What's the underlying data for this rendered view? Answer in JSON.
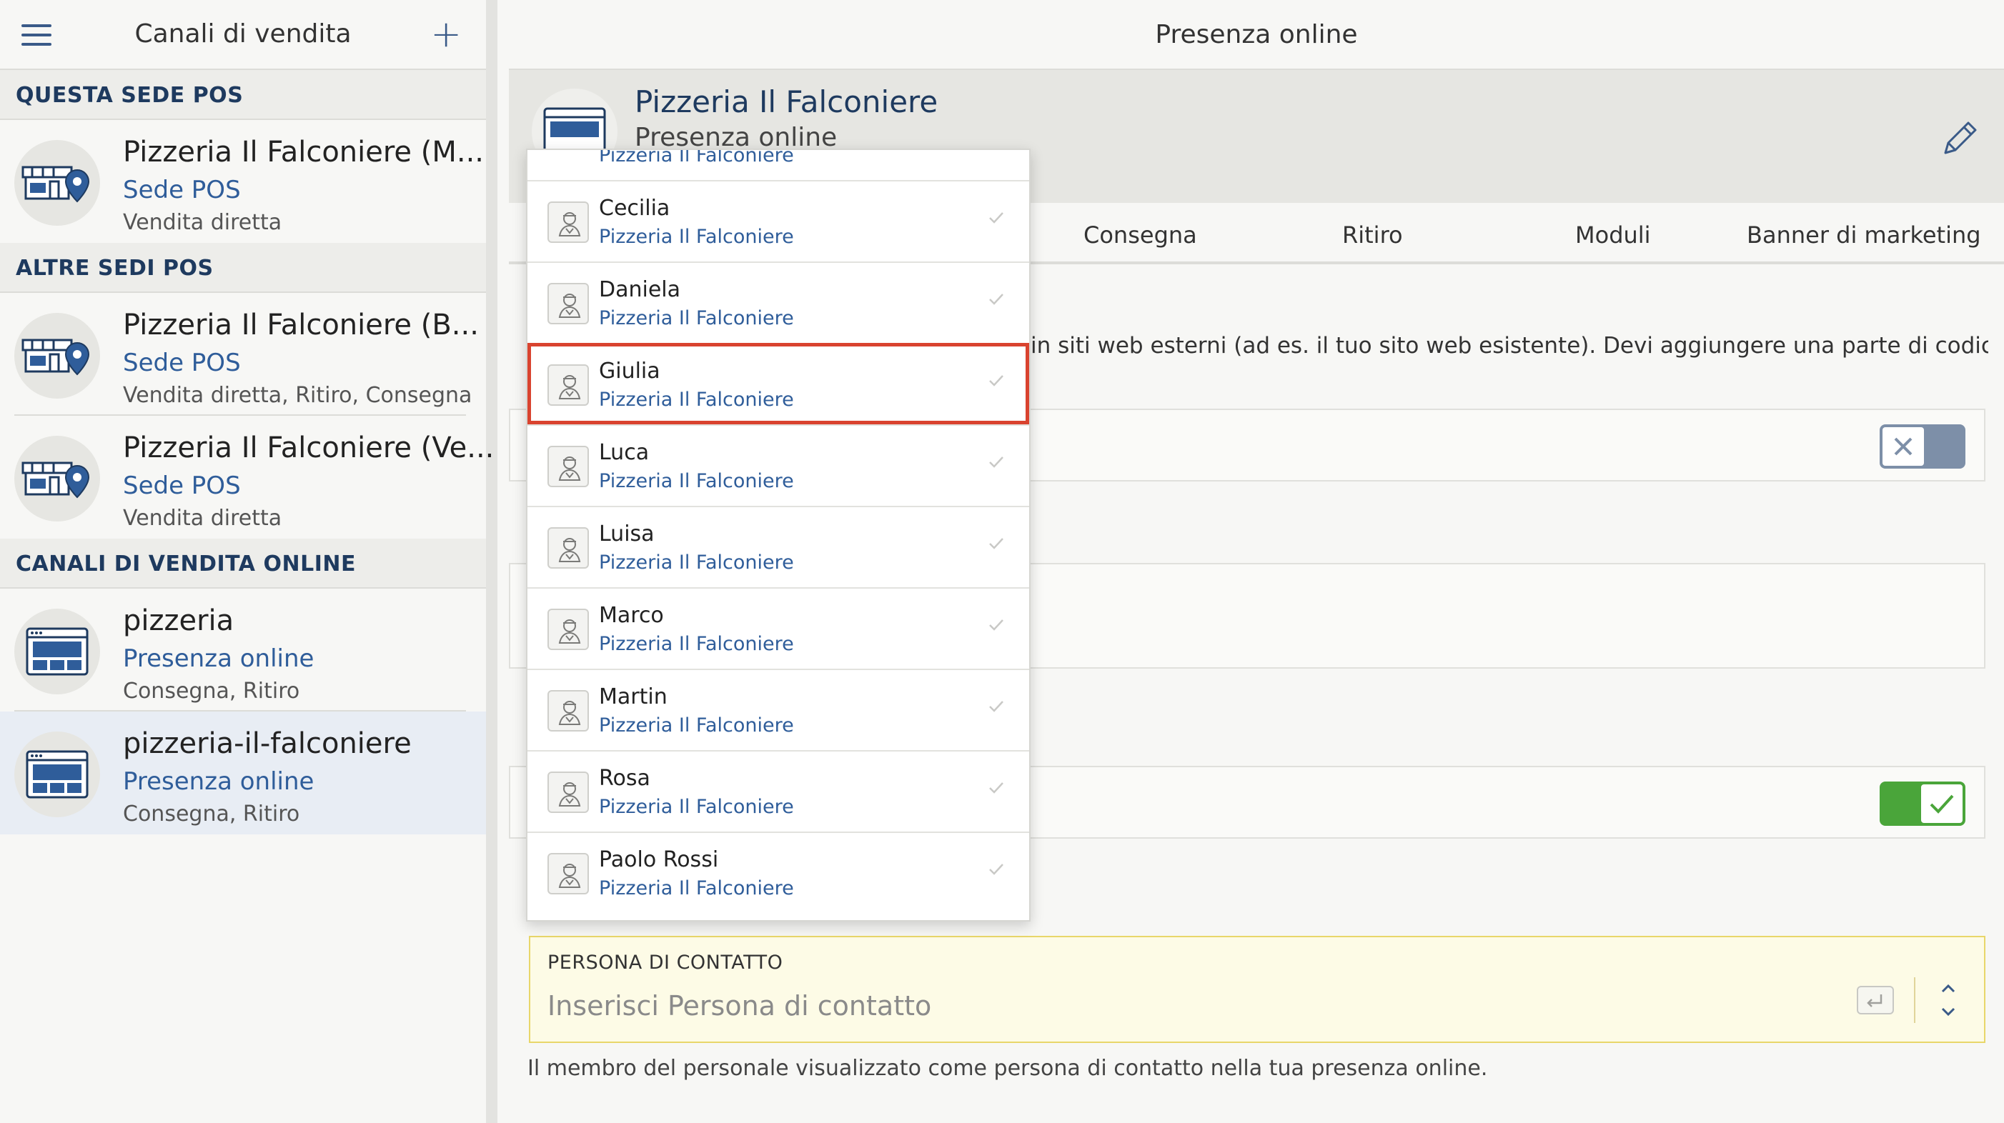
{
  "sidebar": {
    "title": "Canali di vendita",
    "menu_icon": "hamburger-icon",
    "add_icon": "plus-icon",
    "sections": [
      {
        "header": "QUESTA SEDE POS",
        "items": [
          {
            "name": "Pizzeria Il Falconiere (M...",
            "type": "Sede POS",
            "meta": "Vendita diretta",
            "icon": "store-location-icon",
            "selected": false
          }
        ]
      },
      {
        "header": "ALTRE SEDI POS",
        "items": [
          {
            "name": "Pizzeria Il Falconiere (B...",
            "type": "Sede POS",
            "meta": "Vendita diretta, Ritiro, Consegna",
            "icon": "store-location-icon",
            "selected": false
          },
          {
            "name": "Pizzeria Il Falconiere (Ve...",
            "type": "Sede POS",
            "meta": "Vendita diretta",
            "icon": "store-location-icon",
            "selected": false
          }
        ]
      },
      {
        "header": "CANALI DI VENDITA ONLINE",
        "items": [
          {
            "name": "pizzeria",
            "type": "Presenza online",
            "meta": "Consegna, Ritiro",
            "icon": "website-icon",
            "selected": false
          },
          {
            "name": "pizzeria-il-falconiere",
            "type": "Presenza online",
            "meta": "Consegna, Ritiro",
            "icon": "website-icon",
            "selected": true
          }
        ]
      }
    ]
  },
  "main": {
    "header_title": "Presenza online",
    "banner": {
      "title": "Pizzeria Il Falconiere",
      "subtitle": "Presenza online",
      "edit_icon": "pencil-icon"
    },
    "tabs": [
      "Consegna",
      "Ritiro",
      "Moduli",
      "Banner di marketing"
    ],
    "description": "in siti web esterni (ad es. il tuo sito web esistente). Devi aggiungere una parte di codice HTML al sito",
    "toggle_1": "off",
    "toggle_2": "on",
    "contact": {
      "label": "PERSONA DI CONTATTO",
      "placeholder": "Inserisci Persona di contatto",
      "help": "Il membro del personale visualizzato come persona di contatto nella tua presenza online."
    }
  },
  "dropdown": {
    "partial_top": "Pizzeria Il Falconiere",
    "items": [
      {
        "name": "Cecilia",
        "sub": "Pizzeria Il Falconiere",
        "highlight": false
      },
      {
        "name": "Daniela",
        "sub": "Pizzeria Il Falconiere",
        "highlight": false
      },
      {
        "name": "Giulia",
        "sub": "Pizzeria Il Falconiere",
        "highlight": true
      },
      {
        "name": "Luca",
        "sub": "Pizzeria Il Falconiere",
        "highlight": false
      },
      {
        "name": "Luisa",
        "sub": "Pizzeria Il Falconiere",
        "highlight": false
      },
      {
        "name": "Marco",
        "sub": "Pizzeria Il Falconiere",
        "highlight": false
      },
      {
        "name": "Martin",
        "sub": "Pizzeria Il Falconiere",
        "highlight": false
      },
      {
        "name": "Rosa",
        "sub": "Pizzeria Il Falconiere",
        "highlight": false
      },
      {
        "name": "Paolo Rossi",
        "sub": "Pizzeria Il Falconiere",
        "highlight": false
      }
    ]
  },
  "colors": {
    "accent": "#2f5d9a",
    "highlight_border": "#d9432f",
    "toggle_on": "#4aa53a",
    "toggle_off": "#7d8fa8",
    "contact_bg": "#fdfbe6"
  }
}
